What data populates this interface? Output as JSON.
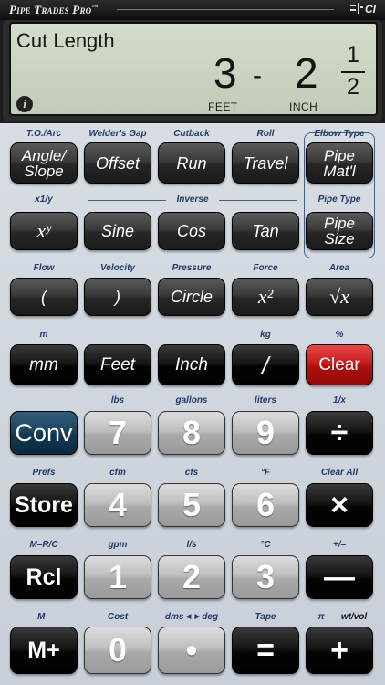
{
  "header": {
    "brand": "Pipe Trades Pro",
    "tm": "™",
    "logo": "CI"
  },
  "display": {
    "mode": "Cut Length",
    "feet_value": "3",
    "separator": "-",
    "inch_value": "2",
    "fraction_numerator": "1",
    "fraction_denominator": "2",
    "feet_unit": "FEET",
    "inch_unit": "INCH",
    "info_icon": "i"
  },
  "secondary": {
    "row1": [
      "T.O./Arc",
      "Welder's Gap",
      "Cutback",
      "Roll",
      "Elbow Type"
    ],
    "row2_left": "x1/y",
    "row2_inverse": "Inverse",
    "row2_right": "Pipe Type",
    "row3": [
      "Flow",
      "Velocity",
      "Pressure",
      "Force",
      "Area"
    ],
    "row4": [
      "m",
      "",
      "",
      "kg",
      "%"
    ],
    "row5": [
      "",
      "lbs",
      "gallons",
      "liters",
      "1/x"
    ],
    "row6": [
      "Prefs",
      "cfm",
      "cfs",
      "°F",
      "Clear All"
    ],
    "row7": [
      "M–R/C",
      "gpm",
      "l/s",
      "°C",
      "+/–"
    ],
    "row8": [
      "M–",
      "Cost",
      "dms◄►deg",
      "Tape",
      "π"
    ],
    "row8_extra": "wt/vol"
  },
  "keys": {
    "row1": [
      "Angle/\nSlope",
      "Offset",
      "Run",
      "Travel",
      "Pipe\nMat'l"
    ],
    "row2": [
      "xʸ",
      "Sine",
      "Cos",
      "Tan",
      "Pipe\nSize"
    ],
    "row3": [
      "(",
      ")",
      "Circle",
      "x²",
      "√x"
    ],
    "row4": [
      "mm",
      "Feet",
      "Inch",
      "/",
      "Clear"
    ],
    "row5": [
      "Conv",
      "7",
      "8",
      "9",
      "÷"
    ],
    "row6": [
      "Store",
      "4",
      "5",
      "6",
      "×"
    ],
    "row7": [
      "Rcl",
      "1",
      "2",
      "3",
      "—"
    ],
    "row8": [
      "M+",
      "0",
      "•",
      "=",
      "+"
    ]
  },
  "colors": {
    "accent_label": "#223a6a",
    "display_bg": "#c9d2bf",
    "clear_key": "#c71b1b",
    "conv_key": "#1d4560",
    "keypad_bg": "#d2d8e0"
  }
}
